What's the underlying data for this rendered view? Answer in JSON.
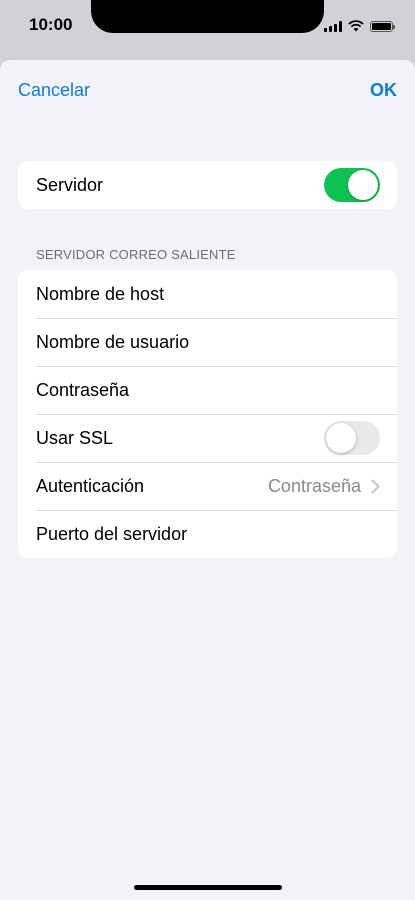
{
  "status_bar": {
    "time": "10:00"
  },
  "nav": {
    "cancel_label": "Cancelar",
    "ok_label": "OK"
  },
  "server": {
    "label": "Servidor",
    "toggle_on": true,
    "toggle_color": "#0dc253"
  },
  "outgoing": {
    "header": "SERVIDOR CORREO SALIENTE",
    "rows": [
      {
        "label": "Nombre de host"
      },
      {
        "label": "Nombre de usuario"
      },
      {
        "label": "Contraseña"
      },
      {
        "label": "Usar SSL",
        "toggle_on": false
      },
      {
        "label": "Autenticación",
        "value": "Contraseña"
      },
      {
        "label": "Puerto del servidor"
      }
    ]
  },
  "colors": {
    "accent": "#0a7ddb",
    "background": "#f2f2f7"
  }
}
